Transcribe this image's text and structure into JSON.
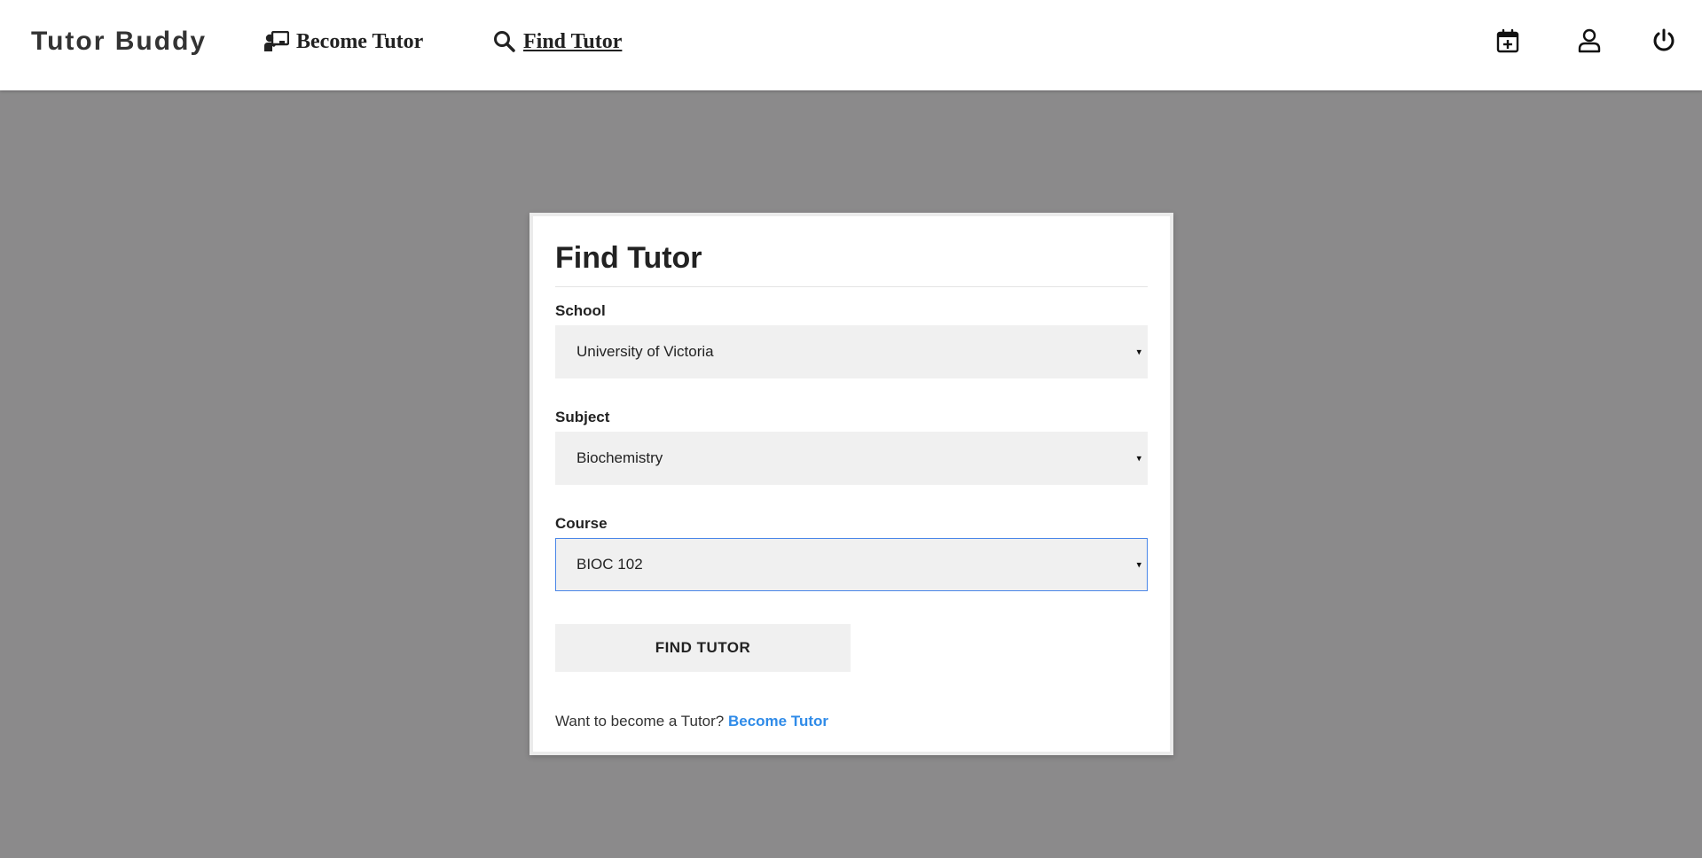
{
  "header": {
    "brand": "Tutor Buddy",
    "nav": [
      {
        "label": "Become Tutor",
        "icon": "chalkboard-teacher-icon"
      },
      {
        "label": "Find Tutor",
        "icon": "search-icon",
        "active": true
      }
    ],
    "icons": [
      "calendar-plus-icon",
      "user-icon",
      "power-icon"
    ]
  },
  "form": {
    "title": "Find Tutor",
    "school_label": "School",
    "school_value": "University of Victoria",
    "subject_label": "Subject",
    "subject_value": "Biochemistry",
    "course_label": "Course",
    "course_value": "BIOC 102",
    "dropdown_arrow": "▾",
    "submit_label": "FIND TUTOR",
    "footer_text": "Want to become a Tutor? ",
    "footer_link": "Become Tutor"
  },
  "colors": {
    "background": "#8b8a8b",
    "link": "#2f8be8",
    "focus_border": "#4a86e8"
  }
}
